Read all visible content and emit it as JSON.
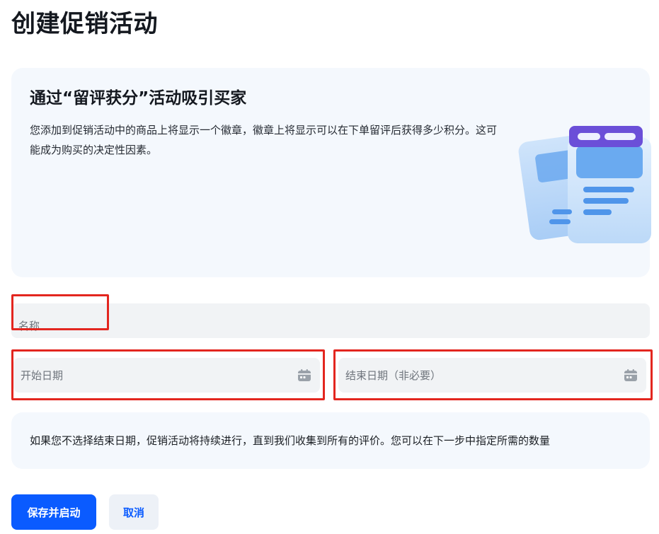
{
  "page": {
    "title": "创建促销活动"
  },
  "banner": {
    "title": "通过“留评获分”活动吸引买家",
    "description": "您添加到促销活动中的商品上将显示一个徽章，徽章上将显示可以在下单留评后获得多少积分。这可能成为购买的决定性因素。",
    "illustration": "documents-illustration"
  },
  "form": {
    "name": {
      "placeholder": "名称",
      "value": ""
    },
    "start_date": {
      "placeholder": "开始日期",
      "value": "",
      "icon": "calendar-icon"
    },
    "end_date": {
      "placeholder": "结束日期（非必要）",
      "value": "",
      "icon": "calendar-icon"
    }
  },
  "info": {
    "text": "如果您不选择结束日期，促销活动将持续进行，直到我们收集到所有的评价。您可以在下一步中指定所需的数量"
  },
  "actions": {
    "save_label": "保存并启动",
    "cancel_label": "取消"
  },
  "colors": {
    "primary": "#0a5bff",
    "highlight": "#e3261f",
    "panel_bg": "#f4f8fd",
    "field_bg": "#f1f3f5"
  }
}
